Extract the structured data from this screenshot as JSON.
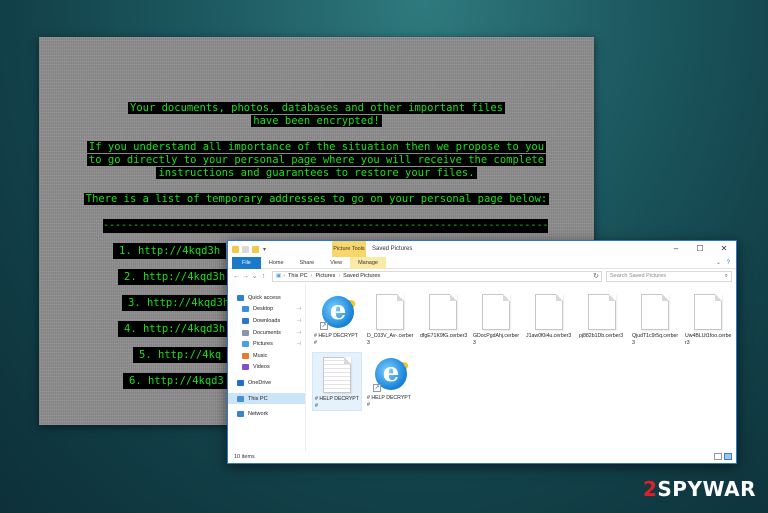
{
  "note": {
    "lines": [
      "Your documents, photos, databases and other important files",
      "have been encrypted!",
      "If you understand all importance of the situation then we propose to you",
      "to go directly to your personal page where you will receive the complete",
      "instructions and guarantees to restore your files.",
      "There is a list of temporary addresses to go on your personal page below:"
    ],
    "dashes": "-------------------------------------------------------------------------------",
    "urls": [
      "1.  http://4kqd3h",
      "2.  http://4kqd3h",
      "3.  http://4kqd3h",
      "4.  http://4kqd3h",
      "5.  http://4kq",
      "6.  http://4kqd3"
    ]
  },
  "explorer": {
    "contextual_tab": "Picture Tools",
    "title": "Saved Pictures",
    "ribbon_tabs": [
      "File",
      "Home",
      "Share",
      "View",
      "Manage"
    ],
    "breadcrumb": [
      "This PC",
      "Pictures",
      "Saved Pictures"
    ],
    "search_placeholder": "Search Saved Pictures",
    "nav": [
      {
        "label": "Quick access",
        "icon": "star-icon",
        "color": "#2f7fd8",
        "pinned": false,
        "indent": 0
      },
      {
        "label": "Desktop",
        "icon": "desktop-icon",
        "color": "#3b8fe0",
        "pinned": true,
        "indent": 1
      },
      {
        "label": "Downloads",
        "icon": "download-icon",
        "color": "#2b78c6",
        "pinned": true,
        "indent": 1
      },
      {
        "label": "Documents",
        "icon": "documents-icon",
        "color": "#8a96a8",
        "pinned": true,
        "indent": 1
      },
      {
        "label": "Pictures",
        "icon": "pictures-icon",
        "color": "#4aa0e3",
        "pinned": true,
        "indent": 1
      },
      {
        "label": "Music",
        "icon": "music-icon",
        "color": "#e37c2b",
        "pinned": false,
        "indent": 1
      },
      {
        "label": "Videos",
        "icon": "videos-icon",
        "color": "#7b55c9",
        "pinned": false,
        "indent": 1
      },
      {
        "label": "OneDrive",
        "icon": "cloud-icon",
        "color": "#1d6fd1",
        "pinned": false,
        "indent": 0
      },
      {
        "label": "This PC",
        "icon": "computer-icon",
        "color": "#4a8fd2",
        "pinned": false,
        "indent": 0
      },
      {
        "label": "Network",
        "icon": "network-icon",
        "color": "#3a84cf",
        "pinned": false,
        "indent": 0
      }
    ],
    "nav_selected": "This PC",
    "files": [
      {
        "name": "# HELP DECRYPT #",
        "icon": "internet-explorer-icon"
      },
      {
        "name": "D_C03V_Av-.cerber3",
        "icon": "file-icon"
      },
      {
        "name": "dfgE71K9fG.cerber3",
        "icon": "file-icon"
      },
      {
        "name": "GDocPgdAhj.cerber3",
        "icon": "file-icon"
      },
      {
        "name": "J1aw0f0i4u.cerber3",
        "icon": "file-icon"
      },
      {
        "name": "pj882b1Db.cerber3",
        "icon": "file-icon"
      },
      {
        "name": "QjudT1c9r5q.cerber3",
        "icon": "file-icon"
      },
      {
        "name": "Uw4BLUt1foo.cerber3",
        "icon": "file-icon"
      },
      {
        "name": "# HELP DECRYPT #",
        "icon": "text-document-icon"
      },
      {
        "name": "# HELP DECRYPT #",
        "icon": "internet-explorer-icon"
      }
    ],
    "status": "10 items"
  },
  "watermark": {
    "brand_red": "2",
    "brand_white": "SPYWAR"
  }
}
